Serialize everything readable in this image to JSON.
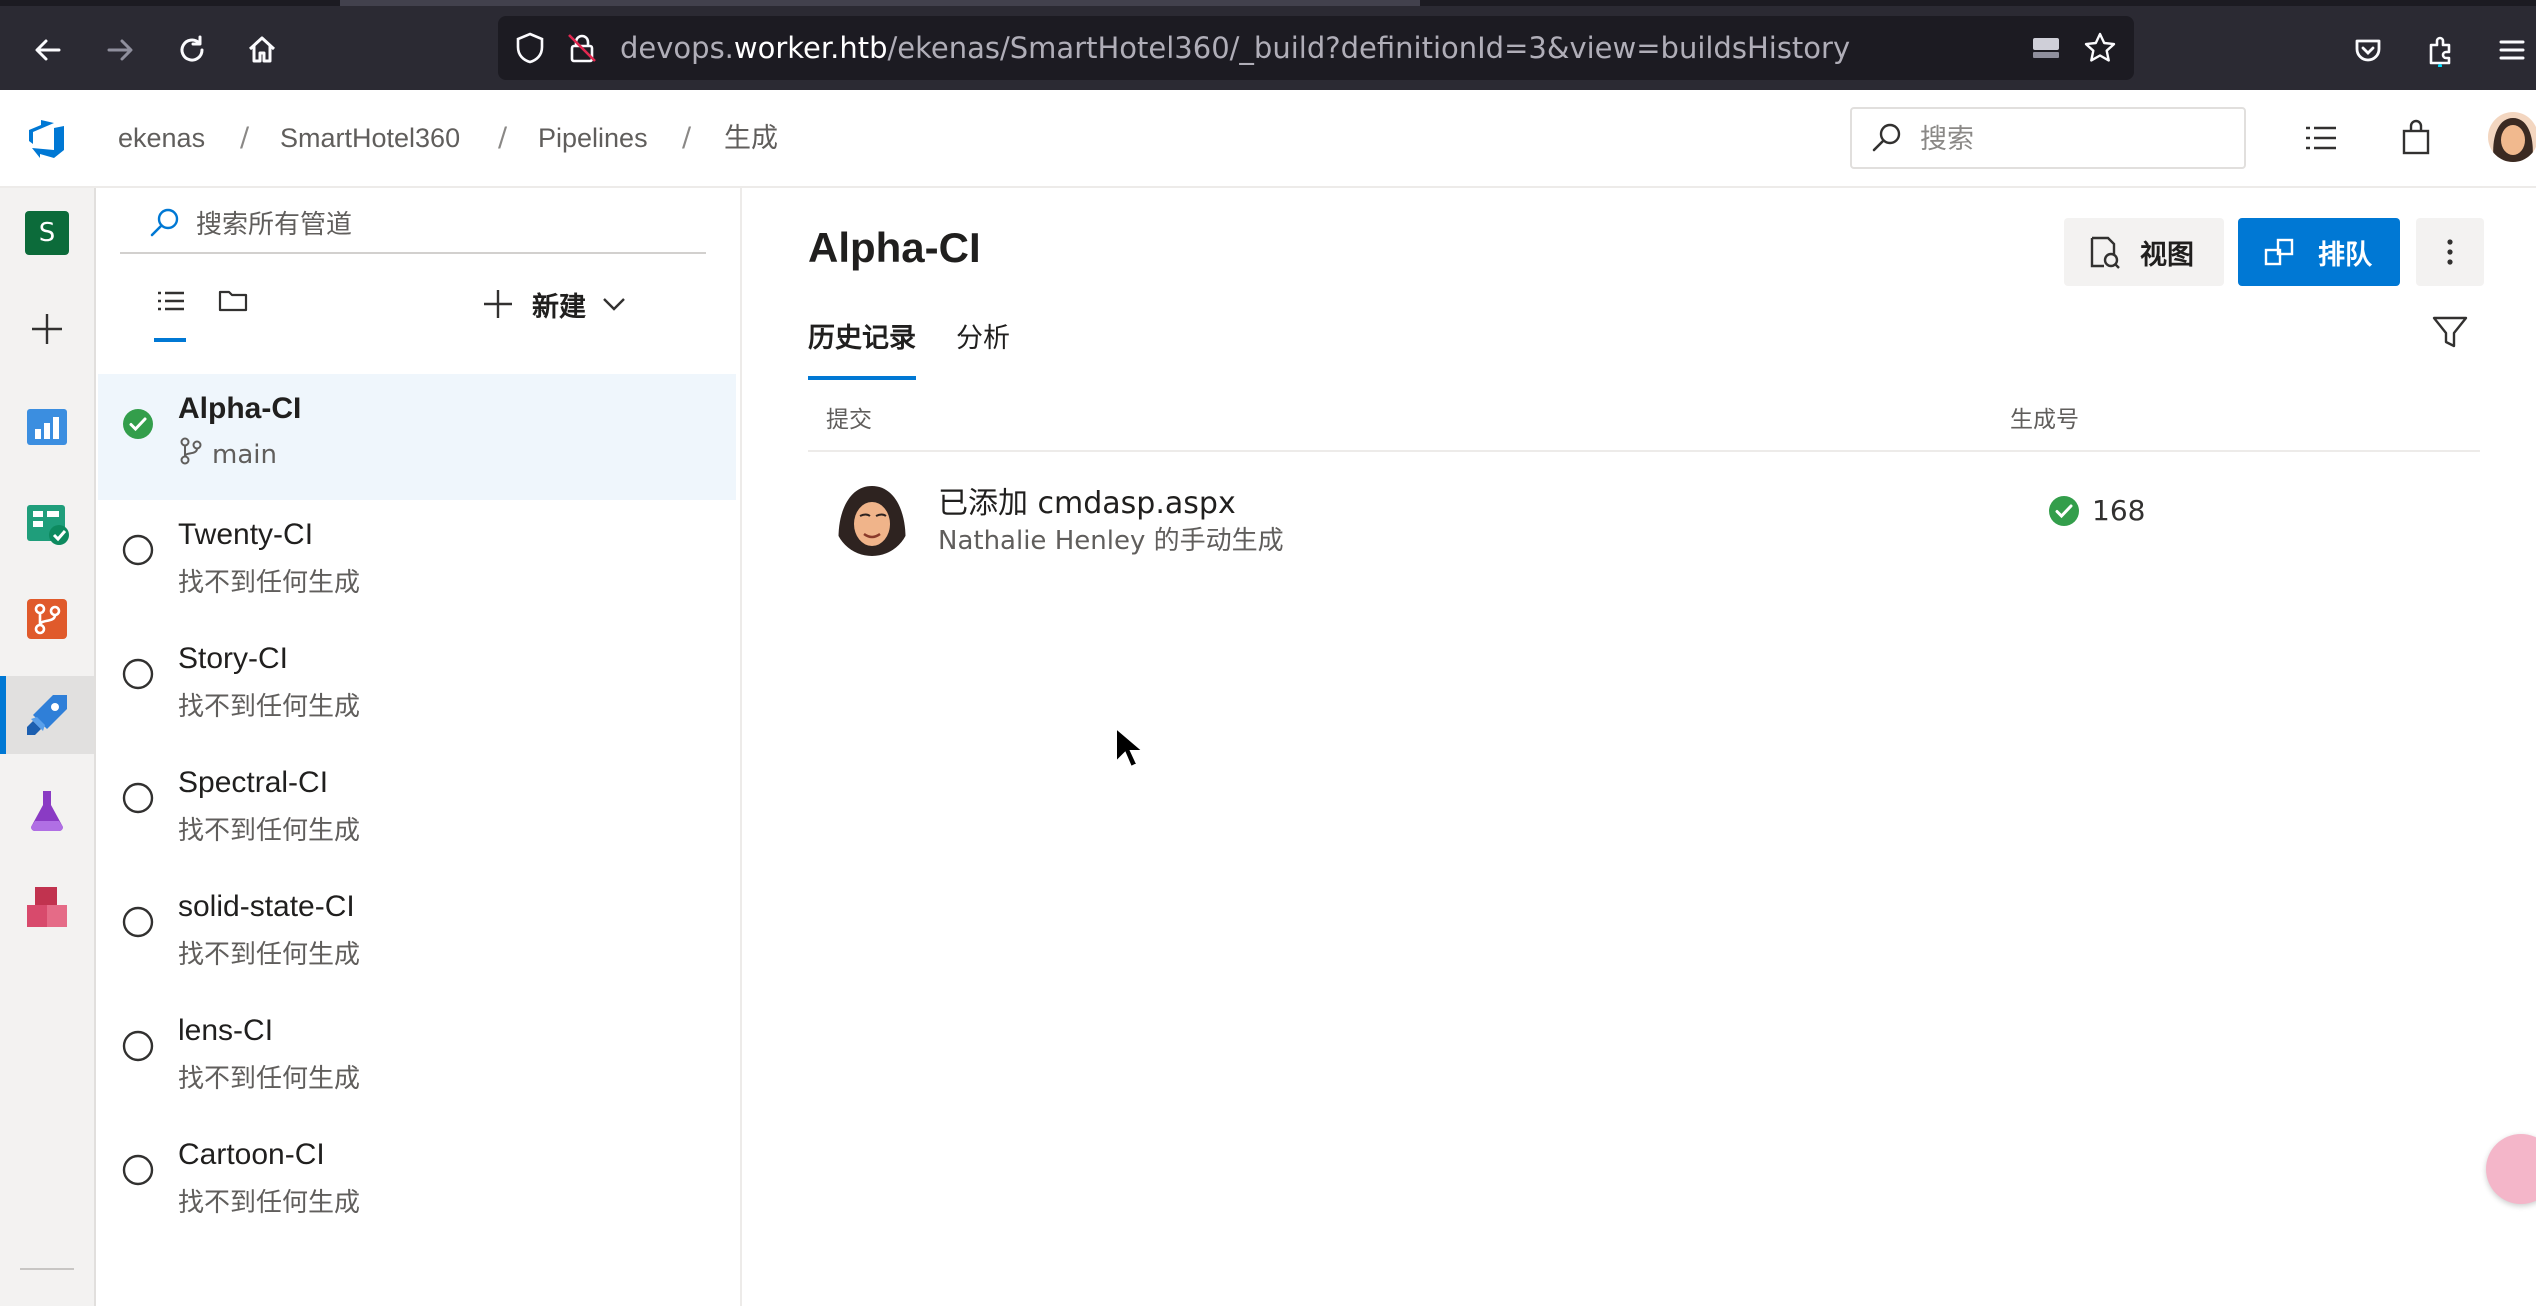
{
  "browser": {
    "url_prefix": "devops.",
    "url_host": "worker.htb",
    "url_path": "/ekenas/SmartHotel360/_build?definitionId=3&view=buildsHistory"
  },
  "header": {
    "breadcrumbs": [
      {
        "label": "ekenas"
      },
      {
        "label": "SmartHotel360"
      },
      {
        "label": "Pipelines"
      },
      {
        "label": "生成"
      }
    ],
    "search_placeholder": "搜索"
  },
  "rail": {
    "project_avatar_letter": "S"
  },
  "panel": {
    "search_placeholder": "搜索所有管道",
    "new_label": "新建",
    "pipelines": [
      {
        "name": "Alpha-CI",
        "sub": "main",
        "status": "succeeded"
      },
      {
        "name": "Twenty-CI",
        "sub": "找不到任何生成",
        "status": "none"
      },
      {
        "name": "Story-CI",
        "sub": "找不到任何生成",
        "status": "none"
      },
      {
        "name": "Spectral-CI",
        "sub": "找不到任何生成",
        "status": "none"
      },
      {
        "name": "solid-state-CI",
        "sub": "找不到任何生成",
        "status": "none"
      },
      {
        "name": "lens-CI",
        "sub": "找不到任何生成",
        "status": "none"
      },
      {
        "name": "Cartoon-CI",
        "sub": "找不到任何生成",
        "status": "none"
      }
    ]
  },
  "main": {
    "title": "Alpha-CI",
    "view_label": "视图",
    "queue_label": "排队",
    "tabs": [
      {
        "label": "历史记录",
        "active": true
      },
      {
        "label": "分析",
        "active": false
      }
    ],
    "columns": {
      "commit": "提交",
      "build_number": "生成号"
    },
    "runs": [
      {
        "title": "已添加 cmdasp.aspx",
        "subtitle": "Nathalie Henley 的手动生成",
        "number": "168",
        "status": "succeeded"
      }
    ]
  },
  "colors": {
    "accent": "#0078d4",
    "success": "#339e4b",
    "browser_chrome": "#2b2a33"
  }
}
